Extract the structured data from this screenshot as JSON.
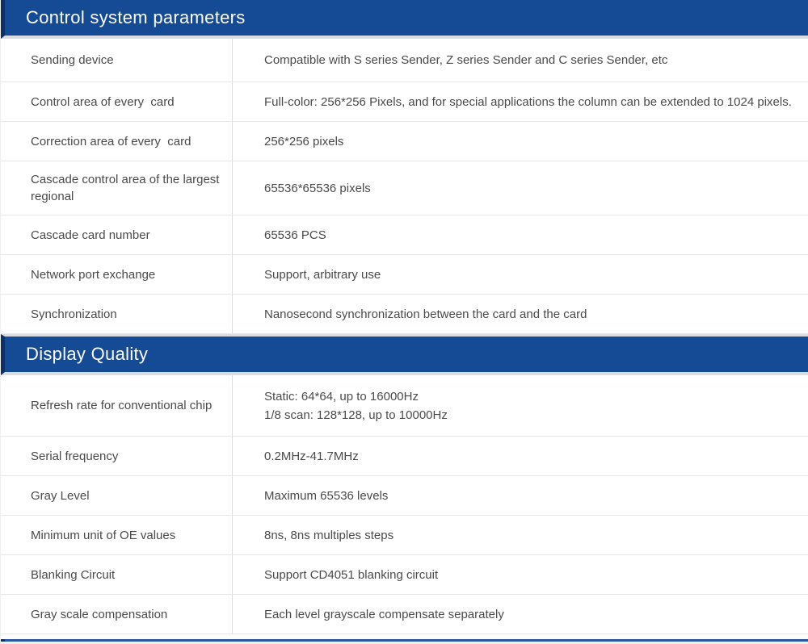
{
  "colors": {
    "header_background": "#154a94",
    "header_left_accent": "#0e3063",
    "header_text": "#ffffff",
    "body_text": "#4a4a4a",
    "row_border": "#e6e6e8",
    "column_divider": "#dcdcde",
    "header_band": "#d9dce3",
    "bottom_rule_blue": "#27569e"
  },
  "sections": [
    {
      "title": "Control system parameters",
      "rows": [
        {
          "label": "Sending device",
          "value": "Compatible with S series Sender, Z series Sender and C series Sender, etc"
        },
        {
          "label": "Control area of every  card",
          "value": "Full-color: 256*256 Pixels, and for special applications the column can be extended to 1024 pixels."
        },
        {
          "label": "Correction area of every  card",
          "value": "256*256 pixels"
        },
        {
          "label": "Cascade control area of the largest regional",
          "value": "65536*65536 pixels"
        },
        {
          "label": "Cascade card number",
          "value": "65536 PCS"
        },
        {
          "label": "Network port exchange",
          "value": "Support, arbitrary use"
        },
        {
          "label": "Synchronization",
          "value": "Nanosecond synchronization between the card and the card"
        }
      ]
    },
    {
      "title": "Display Quality",
      "rows": [
        {
          "label": "Refresh rate for conventional chip",
          "value": "Static: 64*64, up to 16000Hz\n1/8 scan: 128*128, up to 10000Hz"
        },
        {
          "label": "Serial frequency",
          "value": "0.2MHz-41.7MHz"
        },
        {
          "label": "Gray Level",
          "value": "Maximum 65536 levels"
        },
        {
          "label": "Minimum unit of OE values",
          "value": "8ns, 8ns multiples steps"
        },
        {
          "label": "Blanking Circuit",
          "value": "Support CD4051 blanking circuit"
        },
        {
          "label": "Gray scale compensation",
          "value": "Each level grayscale compensate separately"
        }
      ]
    }
  ]
}
